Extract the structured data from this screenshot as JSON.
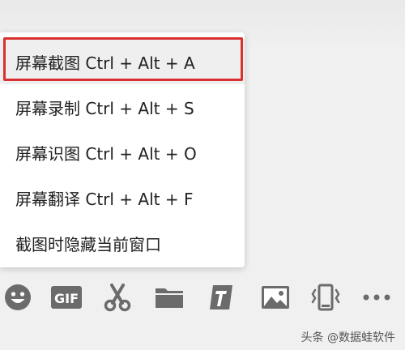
{
  "menu": {
    "items": [
      {
        "label": "屏幕截图 Ctrl + Alt + A",
        "highlighted": true
      },
      {
        "label": "屏幕录制 Ctrl + Alt + S",
        "highlighted": false
      },
      {
        "label": "屏幕识图 Ctrl + Alt + O",
        "highlighted": false
      },
      {
        "label": "屏幕翻译 Ctrl + Alt + F",
        "highlighted": false
      },
      {
        "label": "截图时隐藏当前窗口",
        "highlighted": false
      }
    ],
    "highlight_color": "#d9312f"
  },
  "toolbar": {
    "icons": [
      "emoji-icon",
      "gif-icon",
      "scissors-icon",
      "folder-icon",
      "text-format-icon",
      "image-icon",
      "shake-icon",
      "more-icon"
    ],
    "gif_label": "GIF",
    "icon_color": "#6b6b6b"
  },
  "watermark": {
    "text": "头条 @数据蛙软件"
  }
}
